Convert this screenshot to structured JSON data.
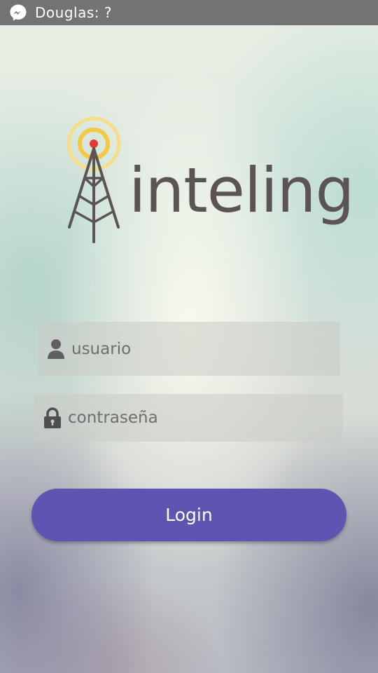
{
  "status_bar": {
    "icon": "messenger-icon",
    "notification_text": "Douglas: ?",
    "background_color": "#737373"
  },
  "logo": {
    "brand_name": "inteling",
    "icon": "radio-tower-icon",
    "text_color": "#5b5354",
    "signal_color": "#f5c842",
    "beacon_color": "#e53935"
  },
  "form": {
    "username": {
      "placeholder": "usuario",
      "value": "",
      "icon": "user-icon"
    },
    "password": {
      "placeholder": "contraseña",
      "value": "",
      "icon": "lock-icon"
    },
    "login_button": {
      "label": "Login",
      "color": "#5e55b2"
    }
  }
}
